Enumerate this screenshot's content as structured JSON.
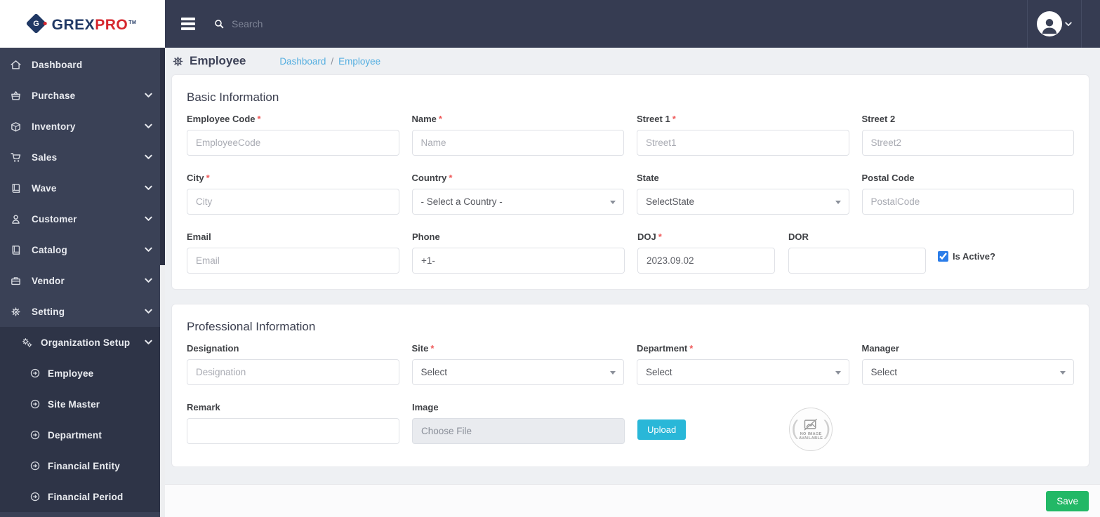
{
  "brand": {
    "grex": "GREX",
    "pro": "PRO",
    "tm": "TM",
    "monogram": "G"
  },
  "topbar": {
    "search_placeholder": "Search"
  },
  "sidebar": {
    "items": [
      {
        "label": "Dashboard",
        "icon": "home-icon"
      },
      {
        "label": "Purchase",
        "icon": "purchase-basket-icon"
      },
      {
        "label": "Inventory",
        "icon": "inventory-box-icon"
      },
      {
        "label": "Sales",
        "icon": "sales-cart-icon"
      },
      {
        "label": "Wave",
        "icon": "wave-book-icon"
      },
      {
        "label": "Customer",
        "icon": "customer-person-icon"
      },
      {
        "label": "Catalog",
        "icon": "catalog-book-icon"
      },
      {
        "label": "Vendor",
        "icon": "vendor-briefcase-icon"
      },
      {
        "label": "Setting",
        "icon": "gear-icon"
      }
    ],
    "organization_setup": {
      "label": "Organization Setup",
      "icon": "gears-icon"
    },
    "submenu_items": [
      {
        "label": "Employee"
      },
      {
        "label": "Site Master"
      },
      {
        "label": "Department"
      },
      {
        "label": "Financial Entity"
      },
      {
        "label": "Financial Period"
      }
    ]
  },
  "page_head": {
    "title": "Employee",
    "breadcrumb_dashboard": "Dashboard",
    "breadcrumb_sep": "/",
    "breadcrumb_current": "Employee"
  },
  "basic": {
    "title": "Basic Information",
    "employee_code": {
      "label": "Employee Code",
      "required": "*",
      "placeholder": "EmployeeCode"
    },
    "name": {
      "label": "Name",
      "required": "*",
      "placeholder": "Name"
    },
    "street1": {
      "label": "Street 1",
      "required": "*",
      "placeholder": "Street1"
    },
    "street2": {
      "label": "Street 2",
      "required": "",
      "placeholder": "Street2"
    },
    "city": {
      "label": "City",
      "required": "*",
      "placeholder": "City"
    },
    "country": {
      "label": "Country",
      "required": "*",
      "value": "- Select a Country -"
    },
    "state": {
      "label": "State",
      "required": "",
      "value": "SelectState"
    },
    "postal_code": {
      "label": "Postal Code",
      "required": "",
      "placeholder": "PostalCode"
    },
    "email": {
      "label": "Email",
      "required": "",
      "placeholder": "Email"
    },
    "phone": {
      "label": "Phone",
      "required": "",
      "value": "+1-"
    },
    "doj": {
      "label": "DOJ",
      "required": "*",
      "value": "2023.09.02"
    },
    "dor": {
      "label": "DOR",
      "required": "",
      "value": ""
    },
    "is_active": {
      "label": "Is Active?",
      "checked": "checked"
    }
  },
  "professional": {
    "title": "Professional Information",
    "designation": {
      "label": "Designation",
      "required": "",
      "placeholder": "Designation"
    },
    "site": {
      "label": "Site",
      "required": "*",
      "value": "Select"
    },
    "department": {
      "label": "Department",
      "required": "*",
      "value": "Select"
    },
    "manager": {
      "label": "Manager",
      "required": "",
      "value": "Select"
    },
    "remark": {
      "label": "Remark",
      "required": ""
    },
    "image": {
      "label": "Image",
      "required": "",
      "file_label": "Choose File",
      "upload_label": "Upload"
    },
    "no_image": {
      "line1": "NO IMAGE",
      "line2": "AVAILABLE",
      "paren_left": "(",
      "paren_right": ")"
    }
  },
  "footer": {
    "save_label": "Save"
  },
  "colors": {
    "sidebar": "#3a4156",
    "submenu": "#2e3447",
    "topbar": "#363c52",
    "breadcrumb_link": "#54aee0",
    "upload_button": "#29b7d8",
    "save_button": "#22b866",
    "required_marker": "#ef5b5b",
    "checkbox": "#2b7de9",
    "brand_navy": "#203864",
    "brand_red": "#d6272e"
  }
}
